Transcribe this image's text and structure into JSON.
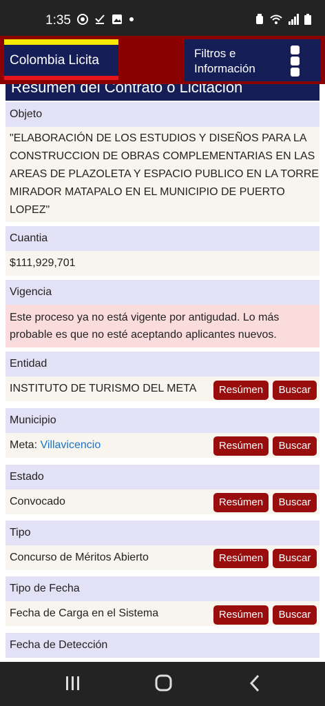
{
  "status_bar": {
    "time": "1:35",
    "icons_left": [
      "chrome-icon",
      "check-download-icon",
      "image-icon",
      "dot-icon"
    ],
    "icons_right": [
      "alarm-icon",
      "wifi-icon",
      "signal-icon",
      "battery-icon"
    ]
  },
  "header": {
    "brand": "Colombia Licita",
    "menu_label": "Filtros e Información",
    "colors": {
      "header_bg": "#8b0000",
      "brand_bg": "#161e57",
      "flag_yellow": "#f9e800",
      "flag_red": "#e8141b"
    }
  },
  "page": {
    "heading": "Resumen del Contrato o Licitación",
    "objeto": {
      "label": "Objeto",
      "value": "\"ELABORACIÓN DE LOS ESTUDIOS Y DISEÑOS PARA LA CONSTRUCCION DE OBRAS COMPLEMENTARIAS EN LAS AREAS DE PLAZOLETA Y ESPACIO PUBLICO EN LA TORRE MIRADOR MATAPALO EN EL MUNICIPIO DE PUERTO LOPEZ\""
    },
    "cuantia": {
      "label": "Cuantia",
      "value": "$111,929,701"
    },
    "vigencia": {
      "label": "Vigencia",
      "warning": "Este proceso ya no está vigente por antigudad. Lo más probable es que no esté aceptando aplicantes nuevos."
    },
    "entidad": {
      "label": "Entidad",
      "value": "INSTITUTO DE TURISMO DEL META"
    },
    "municipio": {
      "label": "Municipio",
      "prefix": "Meta:",
      "link": "Villavicencio"
    },
    "estado": {
      "label": "Estado",
      "value": "Convocado"
    },
    "tipo": {
      "label": "Tipo",
      "value": "Concurso de Méritos Abierto"
    },
    "tipo_fecha": {
      "label": "Tipo de Fecha",
      "value": "Fecha de Carga en el Sistema"
    },
    "fecha_deteccion": {
      "label": "Fecha de Detección"
    },
    "buttons": {
      "resumen": "Resúmen",
      "buscar": "Buscar"
    }
  },
  "nav": {
    "items": [
      "recents-icon",
      "home-icon",
      "back-icon"
    ]
  }
}
